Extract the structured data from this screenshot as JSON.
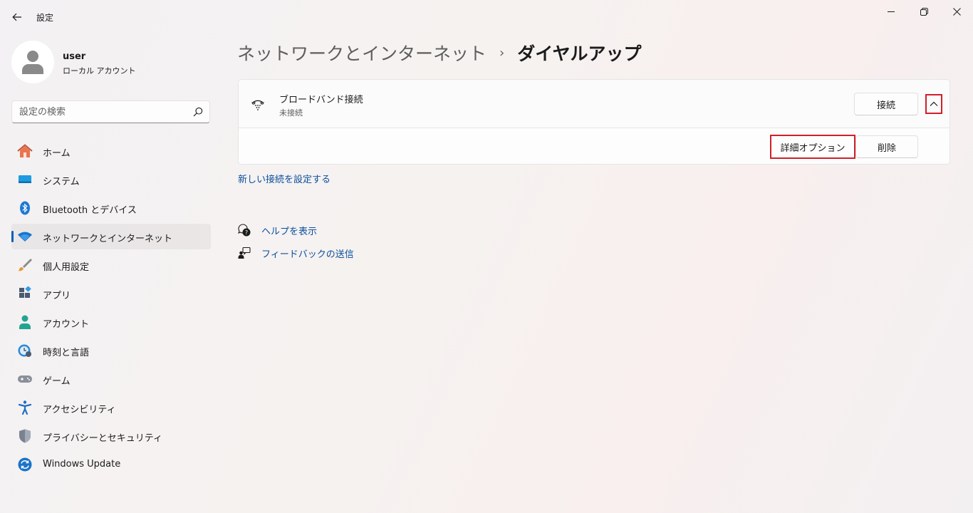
{
  "window": {
    "title": "設定"
  },
  "user": {
    "name": "user",
    "account_type": "ローカル アカウント"
  },
  "search": {
    "placeholder": "設定の検索",
    "value": ""
  },
  "sidebar": {
    "items": [
      {
        "label": "ホーム",
        "icon": "home-icon"
      },
      {
        "label": "システム",
        "icon": "system-icon"
      },
      {
        "label": "Bluetooth とデバイス",
        "icon": "bluetooth-icon"
      },
      {
        "label": "ネットワークとインターネット",
        "icon": "wifi-icon",
        "selected": true
      },
      {
        "label": "個人用設定",
        "icon": "brush-icon"
      },
      {
        "label": "アプリ",
        "icon": "apps-icon"
      },
      {
        "label": "アカウント",
        "icon": "account-icon"
      },
      {
        "label": "時刻と言語",
        "icon": "time-language-icon"
      },
      {
        "label": "ゲーム",
        "icon": "gamepad-icon"
      },
      {
        "label": "アクセシビリティ",
        "icon": "accessibility-icon"
      },
      {
        "label": "プライバシーとセキュリティ",
        "icon": "shield-icon"
      },
      {
        "label": "Windows Update",
        "icon": "windows-update-icon"
      }
    ]
  },
  "breadcrumb": {
    "parent": "ネットワークとインターネット",
    "separator": "›",
    "current": "ダイヤルアップ"
  },
  "connection": {
    "name": "ブロードバンド接続",
    "status": "未接続",
    "connect_label": "接続",
    "advanced_label": "詳細オプション",
    "delete_label": "削除",
    "icon": "dialup-icon"
  },
  "links": {
    "new_connection": "新しい接続を設定する",
    "help": "ヘルプを表示",
    "feedback": "フィードバックの送信"
  },
  "colors": {
    "accent": "#005fb8",
    "link": "#0b4f9c",
    "highlight_box": "#d11f2b"
  }
}
